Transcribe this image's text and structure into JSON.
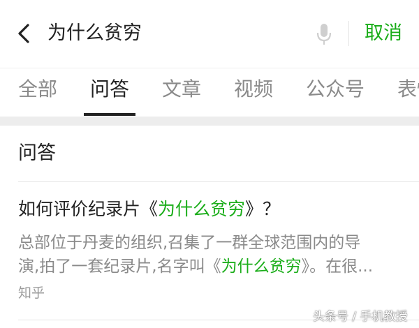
{
  "search": {
    "query": "为什么贫穷",
    "cancel_label": "取消"
  },
  "icons": {
    "back": "chevron-left-icon",
    "mic": "microphone-icon"
  },
  "colors": {
    "accent": "#1aad19",
    "text": "#222222",
    "muted": "#8a8a8a",
    "separator": "#ededed"
  },
  "tabs": [
    {
      "label": "全部",
      "active": false
    },
    {
      "label": "问答",
      "active": true
    },
    {
      "label": "文章",
      "active": false
    },
    {
      "label": "视频",
      "active": false
    },
    {
      "label": "公众号",
      "active": false
    },
    {
      "label": "表情",
      "active": false
    }
  ],
  "section": {
    "title": "问答"
  },
  "results": [
    {
      "title_prefix": "如何评价纪录片《",
      "title_highlight": "为什么贫穷",
      "title_suffix": "》？",
      "snippet_line1": "总部位于丹麦的组织,召集了一群全球范围内的导",
      "snippet_line2_prefix": "演,拍了一套纪录片,名字叫《",
      "snippet_line2_highlight": "为什么贫穷",
      "snippet_line2_suffix": "》。在很...",
      "source": "知乎"
    }
  ],
  "watermark": "头条号 / 手机教授"
}
